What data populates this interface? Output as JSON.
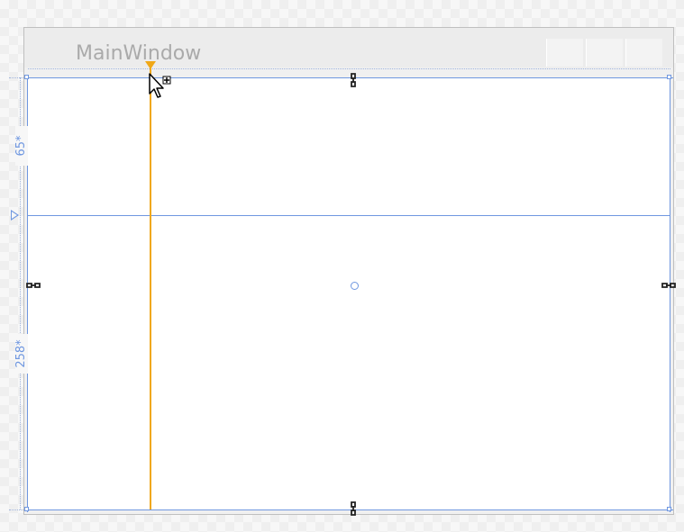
{
  "window": {
    "title": "MainWindow"
  },
  "grid": {
    "rows": [
      {
        "label": "65*"
      },
      {
        "label": "258*"
      }
    ]
  },
  "colors": {
    "guide": "#6f97e0",
    "column_guide": "#f0a818",
    "title_text": "#aaaaaa"
  },
  "icons": {
    "anchor": "chain-link-icon",
    "cursor": "arrow-add-cursor-icon",
    "column_marker": "triangle-down-icon",
    "row_marker": "triangle-right-icon",
    "center": "circle-icon"
  }
}
